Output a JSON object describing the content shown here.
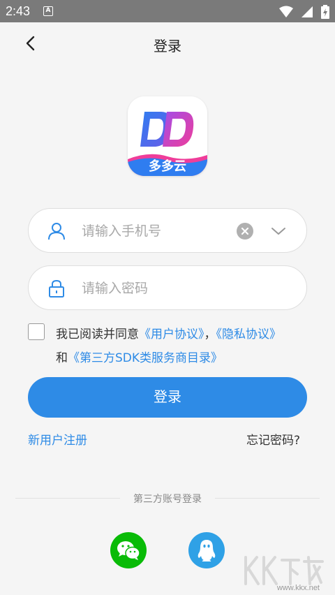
{
  "status_bar": {
    "time": "2:43",
    "notification_letter": "A",
    "icons": [
      "wifi-icon",
      "signal-icon",
      "battery-icon"
    ]
  },
  "header": {
    "title": "登录"
  },
  "logo": {
    "text": "多多云"
  },
  "phone_field": {
    "placeholder": "请输入手机号",
    "value": ""
  },
  "password_field": {
    "placeholder": "请输入密码",
    "value": ""
  },
  "agreement": {
    "checked": false,
    "prefix": "我已阅读并同意",
    "user_agreement": "《用户协议》",
    "separator": "，",
    "privacy_agreement": "《隐私协议》",
    "and": "和",
    "sdk_list": "《第三方SDK类服务商目录》"
  },
  "login_button": "登录",
  "register_link": "新用户注册",
  "forgot_link": "忘记密码?",
  "third_party": {
    "label": "第三方账号登录",
    "options": [
      "wechat-icon",
      "qq-icon"
    ]
  },
  "watermark": {
    "url": "www.kkx.net"
  },
  "colors": {
    "accent": "#2e8be6",
    "wechat": "#09bb07",
    "qq": "#2fa1e6"
  }
}
